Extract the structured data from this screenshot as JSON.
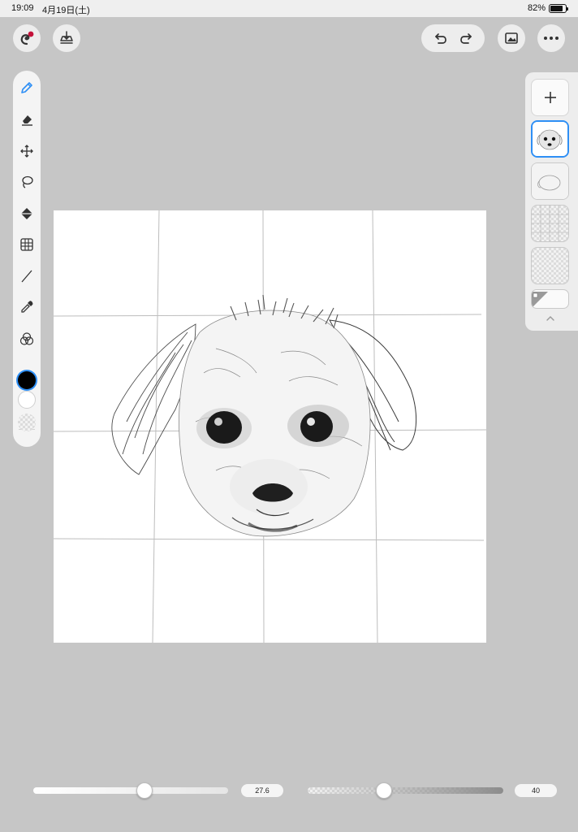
{
  "status_bar": {
    "time": "19:09",
    "date": "4月19日(土)",
    "battery": "82%"
  },
  "header": {
    "left_buttons": [
      "app-logo-icon",
      "import-icon"
    ],
    "right_buttons": [
      "undo-icon",
      "redo-icon",
      "gallery-icon",
      "more-icon"
    ]
  },
  "toolbar": {
    "tools": [
      "pen-icon",
      "eraser-icon",
      "move-icon",
      "lasso-icon",
      "fill-icon",
      "grid-transform-icon",
      "line-icon",
      "eyedropper-icon",
      "blend-icon"
    ],
    "selected_tool": "pen-icon",
    "primary_color": "#000000",
    "secondary_color": "#ffffff",
    "accent": "#2e8ff5"
  },
  "layers": {
    "count": 5,
    "selected_index": 0
  },
  "sliders": {
    "brush_size": {
      "value": "27.6",
      "fill_fraction": 0.57
    },
    "opacity": {
      "value": "40",
      "fill_fraction": 0.39
    }
  }
}
